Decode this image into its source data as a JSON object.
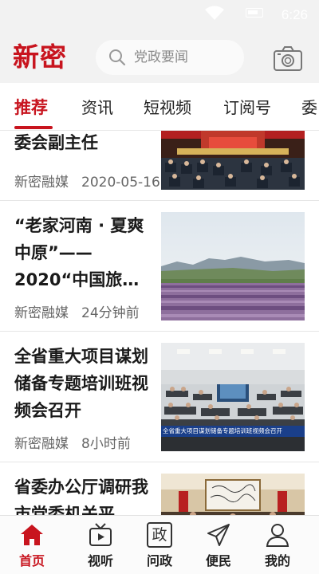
{
  "status": {
    "time": "6:26"
  },
  "header": {
    "logo": "新密",
    "search_placeholder": "党政要闻"
  },
  "tabs": [
    {
      "label": "推荐",
      "active": true
    },
    {
      "label": "资讯"
    },
    {
      "label": "短视频"
    },
    {
      "label": "订阅号"
    },
    {
      "label": "委"
    }
  ],
  "articles": [
    {
      "title": "委会副主任",
      "source": "新密融媒",
      "time": "2020-05-16"
    },
    {
      "title": "“老家河南 · 夏爽中原”——2020“中国旅…",
      "source": "新密融媒",
      "time": "24分钟前"
    },
    {
      "title": "全省重大项目谋划储备专题培训班视频会召开",
      "source": "新密融媒",
      "time": "8小时前",
      "thumb_caption": "全省重大项目谋划储备专题培训班视频会召开"
    },
    {
      "title": "省委办公厅调研我市党委机关平",
      "source": "",
      "time": ""
    }
  ],
  "bottom_nav": [
    {
      "label": "首页",
      "icon": "home-icon",
      "active": true
    },
    {
      "label": "视听",
      "icon": "tv-icon"
    },
    {
      "label": "问政",
      "icon": "wenzheng-icon",
      "glyph": "政"
    },
    {
      "label": "便民",
      "icon": "send-icon"
    },
    {
      "label": "我的",
      "icon": "user-icon"
    }
  ],
  "colors": {
    "brand": "#c8141e",
    "header_bg": "#f2f2f2"
  }
}
